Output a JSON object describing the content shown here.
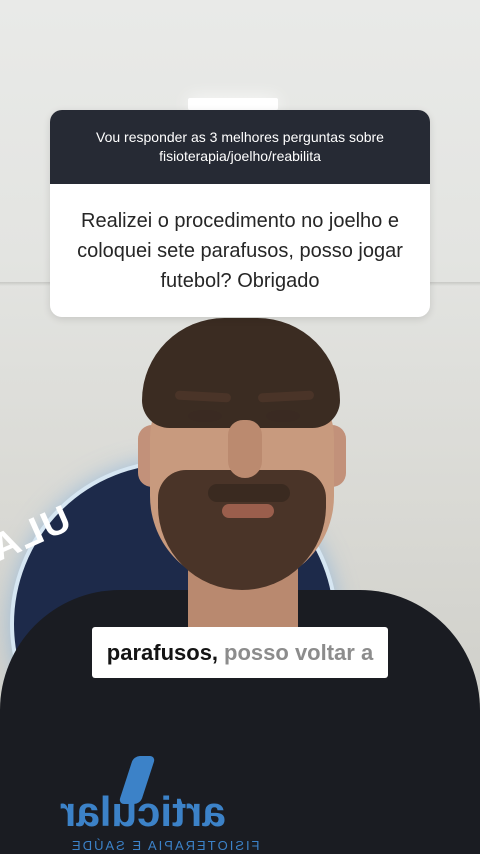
{
  "question_sticker": {
    "header": "Vou responder as 3 melhores perguntas sobre fisioterapia/joelho/reabilita",
    "question": "Realizei o procedimento no joelho e coloquei sete parafusos, posso jogar futebol? Obrigado"
  },
  "caption": {
    "spoken": "parafusos,",
    "pending": "posso voltar a"
  },
  "background": {
    "wall_logo_text": "ULAR",
    "shirt_logo": "articular",
    "shirt_subtext": "FISIOTERAPIA E SAÚDE"
  },
  "colors": {
    "sticker_header_bg": "#262a34",
    "brand_blue": "#3c82c8",
    "caption_pending": "#8c8c8c"
  }
}
